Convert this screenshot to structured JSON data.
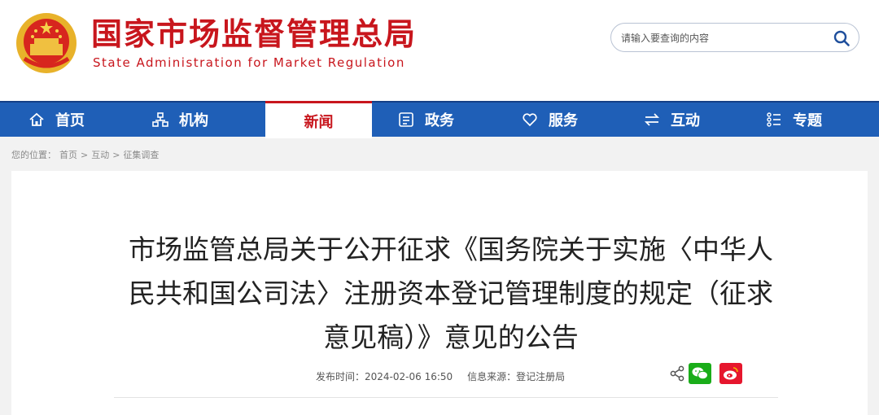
{
  "header": {
    "title_cn": "国家市场监督管理总局",
    "title_en": "State Administration for Market Regulation",
    "search_placeholder": "请输入要查询的内容"
  },
  "nav": {
    "items": [
      {
        "label": "首页",
        "icon": "home-icon"
      },
      {
        "label": "机构",
        "icon": "org-chart-icon"
      },
      {
        "label": "新闻",
        "icon": ""
      },
      {
        "label": "政务",
        "icon": "book-icon"
      },
      {
        "label": "服务",
        "icon": "heart-icon"
      },
      {
        "label": "互动",
        "icon": "exchange-icon"
      },
      {
        "label": "专题",
        "icon": "list-icon"
      }
    ],
    "active": "新闻"
  },
  "breadcrumb": {
    "prefix": "您的位置：",
    "items": [
      "首页",
      "互动",
      "征集调查"
    ],
    "separator": ">"
  },
  "article": {
    "title": "市场监管总局关于公开征求《国务院关于实施〈中华人民共和国公司法〉注册资本登记管理制度的规定（征求意见稿）》意见的公告",
    "publish_label": "发布时间：",
    "publish_time": "2024-02-06 16:50",
    "source_label": "信息来源：",
    "source": "登记注册局"
  },
  "colors": {
    "brand_red": "#c8161d",
    "nav_blue": "#1f5fb7",
    "wechat_green": "#1aad19",
    "weibo_red": "#e6162d"
  }
}
